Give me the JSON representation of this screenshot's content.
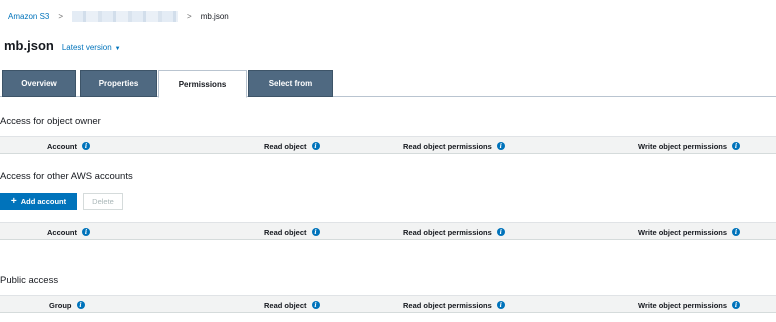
{
  "breadcrumb": {
    "root": "Amazon S3",
    "separator": ">",
    "current": "mb.json"
  },
  "object": {
    "title": "mb.json",
    "version_label": "Latest version",
    "version_caret": "▼"
  },
  "tabs": [
    {
      "label": "Overview",
      "active": false
    },
    {
      "label": "Properties",
      "active": false
    },
    {
      "label": "Permissions",
      "active": true
    },
    {
      "label": "Select from",
      "active": false
    }
  ],
  "owner_section": {
    "title": "Access for object owner",
    "columns": [
      "Account",
      "Read object",
      "Read object permissions",
      "Write object permissions"
    ]
  },
  "other_accounts_section": {
    "title": "Access for other AWS accounts",
    "add_button_icon": "+",
    "add_button": "Add account",
    "delete_button": "Delete",
    "columns": [
      "Account",
      "Read object",
      "Read object permissions",
      "Write object permissions"
    ]
  },
  "public_section": {
    "title": "Public access",
    "columns": [
      "Group",
      "Read object",
      "Read object permissions",
      "Write object permissions"
    ]
  },
  "info_icon_glyph": "i",
  "colors": {
    "link": "#0073bb",
    "tab_inactive": "#4f6981",
    "primary_button": "#0073bb",
    "header_bg": "#f2f3f3"
  }
}
